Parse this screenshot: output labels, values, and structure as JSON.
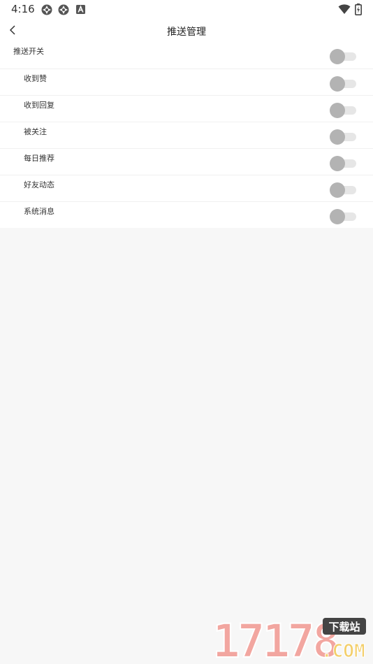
{
  "status_bar": {
    "time": "4:16",
    "icons_left": [
      "app-notification-icon",
      "app-notification-icon",
      "a-notification-icon"
    ],
    "icons_right": [
      "wifi-icon",
      "battery-charging-icon"
    ]
  },
  "navbar": {
    "title": "推送管理",
    "back_icon": "chevron-left-icon"
  },
  "settings": {
    "main": {
      "label": "推送开关",
      "enabled": false
    },
    "items": [
      {
        "label": "收到赞",
        "enabled": false
      },
      {
        "label": "收到回复",
        "enabled": false
      },
      {
        "label": "被关注",
        "enabled": false
      },
      {
        "label": "每日推荐",
        "enabled": false
      },
      {
        "label": "好友动态",
        "enabled": false
      },
      {
        "label": "系统消息",
        "enabled": false
      }
    ]
  },
  "watermark": {
    "number": "17178",
    "badge": "下载站",
    "suffix": ".COM"
  },
  "colors": {
    "background": "#f7f7f7",
    "surface": "#ffffff",
    "toggle_track": "#e6e6e6",
    "toggle_thumb": "#b3b3b3",
    "watermark_pink": "#f2a6a0",
    "watermark_yellow": "#f3cf6b"
  }
}
